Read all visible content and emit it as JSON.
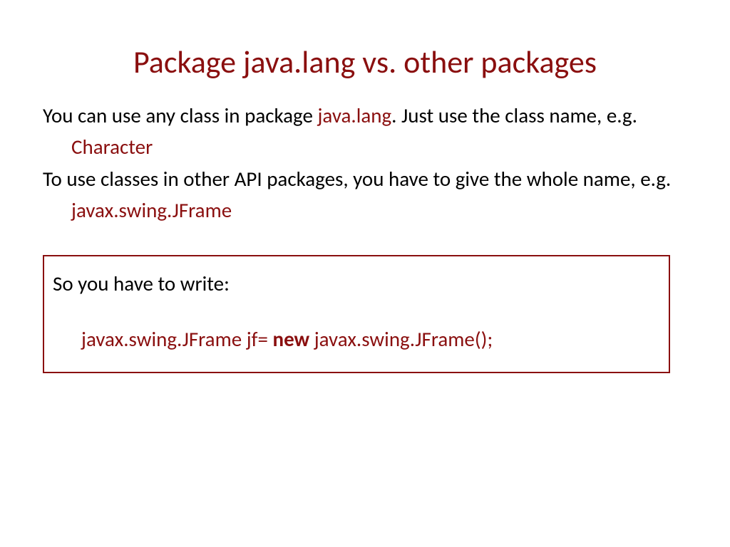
{
  "title": "Package java.lang vs. other packages",
  "p1_a": "You can use any class in package ",
  "p1_b": "java.lang",
  "p1_c": ". Just use the class name, e.g.",
  "p2": "Character",
  "p3": "To use classes in other API packages, you have to give the whole name, e.g.",
  "p4": "javax.swing.JFrame",
  "box": {
    "intro": "So you have to write:",
    "code_a": "javax.swing.JFrame  jf=  ",
    "code_b": "new ",
    "code_c": "javax.swing.JFrame();"
  }
}
